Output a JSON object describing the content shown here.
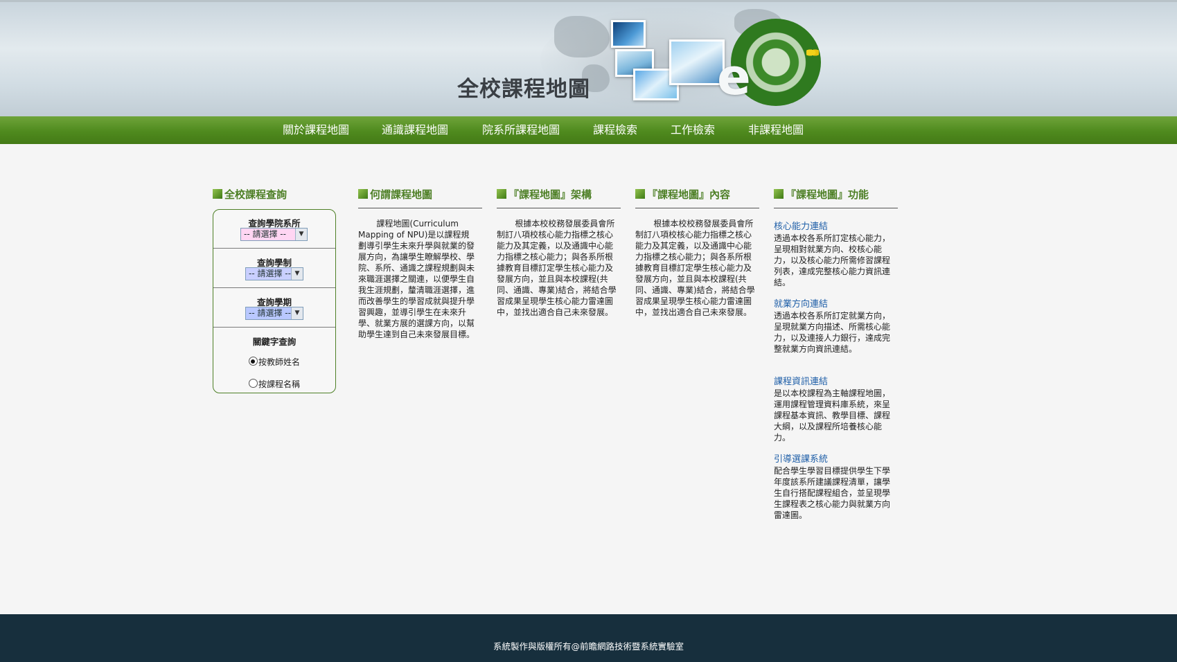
{
  "banner": {
    "title": "全校課程地圖",
    "logo_letter": "e"
  },
  "nav": {
    "items": [
      {
        "label": "關於課程地圖"
      },
      {
        "label": "通識課程地圖"
      },
      {
        "label": "院系所課程地圖"
      },
      {
        "label": "課程檢索"
      },
      {
        "label": "工作檢索"
      },
      {
        "label": "非課程地圖"
      }
    ]
  },
  "query": {
    "heading": "全校課程查詢",
    "department_label": "查詢學院系所",
    "department_value": "-- 請選擇 --",
    "system_label": "查詢學制",
    "system_value": "-- 請選擇 --",
    "term_label": "查詢學期",
    "term_value": "-- 請選擇 --",
    "keyword_label": "關鍵字查詢",
    "radio_teacher": "按教師姓名",
    "radio_course": "按課程名稱",
    "radio_selected": "按教師姓名"
  },
  "sections": {
    "what": {
      "heading": "何謂課程地圖",
      "text": "課程地圖(Curriculum Mapping of NPU)是以課程規劃導引學生未來升學與就業的發展方向，為讓學生瞭解學校、學院、系所、通識之課程規劃與未來職涯選擇之關連，以便學生自我生涯規劃，釐清職涯選擇，進而改善學生的學習成就與提升學習興趣，並導引學生在未來升學、就業方展的選課方向，以幫助學生達到自己未來發展目標。"
    },
    "framework": {
      "heading": "『課程地圖』架構",
      "text": "根據本校校務發展委員會所制訂八項校核心能力指標之核心能力及其定義，以及通識中心能力指標之核心能力；與各系所根據教育目標訂定學生核心能力及發展方向，並且與本校課程(共同、通識、專業)結合，將結合學習成果呈現學生核心能力雷達圖中，並找出適合自己未來發展。"
    },
    "content": {
      "heading": "『課程地圖』內容",
      "text": "根據本校校務發展委員會所制訂八項校核心能力指標之核心能力及其定義，以及通識中心能力指標之核心能力；與各系所根據教育目標訂定學生核心能力及發展方向，並且與本校課程(共同、通識、專業)結合，將結合學習成果呈現學生核心能力雷達圖中，並找出適合自己未來發展。"
    },
    "functions": {
      "heading": "『課程地圖』功能",
      "items": [
        {
          "title": "核心能力連結",
          "text": "透過本校各系所訂定核心能力，呈現相對就業方向、校核心能力，以及核心能力所需修習課程列表，達成完整核心能力資訊連結。"
        },
        {
          "title": "就業方向連結",
          "text": "透過本校各系所訂定就業方向，呈現就業方向描述、所需核心能力，以及連接人力銀行，達成完整就業方向資訊連結。"
        },
        {
          "title": "課程資訊連結",
          "text": "是以本校課程為主軸課程地圖，運用課程管理資料庫系統，來呈課程基本資訊、教學目標、課程大綱，以及課程所培養核心能力。"
        },
        {
          "title": "引導選課系統",
          "text": "配合學生學習目標提供學生下學年度該系所建議課程清單，讓學生自行搭配課程組合，並呈現學生課程表之核心能力與就業方向雷達圖。"
        }
      ]
    }
  },
  "footer": {
    "text": "系統製作與版權所有@前瞻網路技術暨系統實驗室"
  },
  "colors": {
    "nav_green": "#4f8a1e",
    "heading_green": "#4d7f25",
    "link_blue": "#1f5fa8",
    "footer_bg": "#172f3d",
    "department_select_bg": "#ffd6f3",
    "system_select_bg": "#c9cfff",
    "term_select_bg": "#b9c8ff"
  }
}
